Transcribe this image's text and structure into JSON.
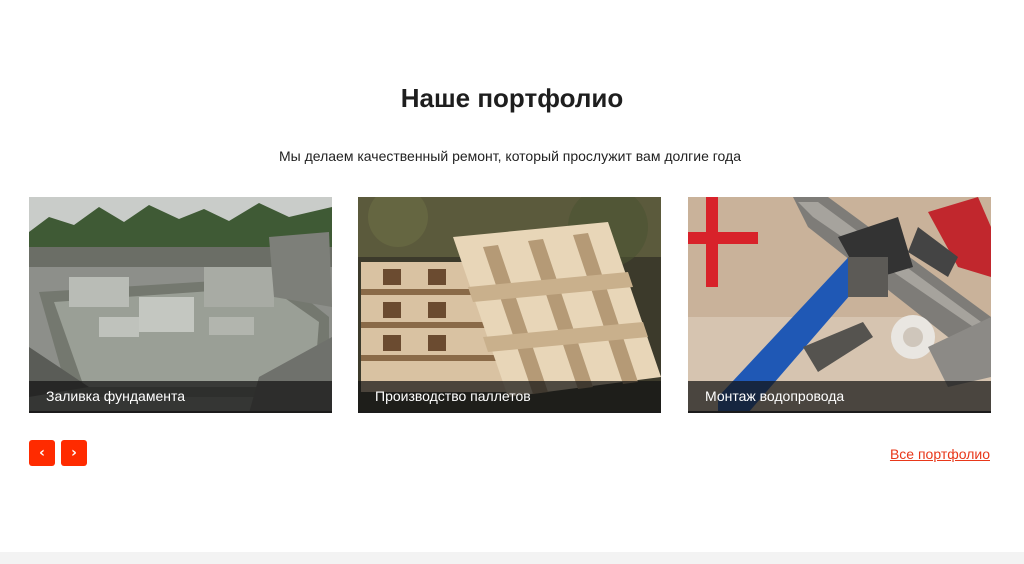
{
  "section": {
    "title": "Наше портфолио",
    "subtitle": "Мы делаем качественный ремонт, который прослужит вам долгие года"
  },
  "portfolio": {
    "items": [
      {
        "caption": "Заливка фундамента",
        "image": "construction-foundation-photo"
      },
      {
        "caption": "Производство паллетов",
        "image": "wooden-pallets-photo"
      },
      {
        "caption": "Монтаж водопровода",
        "image": "pipe-wrenches-photo"
      }
    ]
  },
  "controls": {
    "prev_label": "‹",
    "next_label": "›",
    "all_link": "Все портфолио"
  },
  "colors": {
    "accent": "#ff2b00",
    "link": "#e8381a",
    "caption_bg": "rgba(20,20,20,0.72)"
  }
}
